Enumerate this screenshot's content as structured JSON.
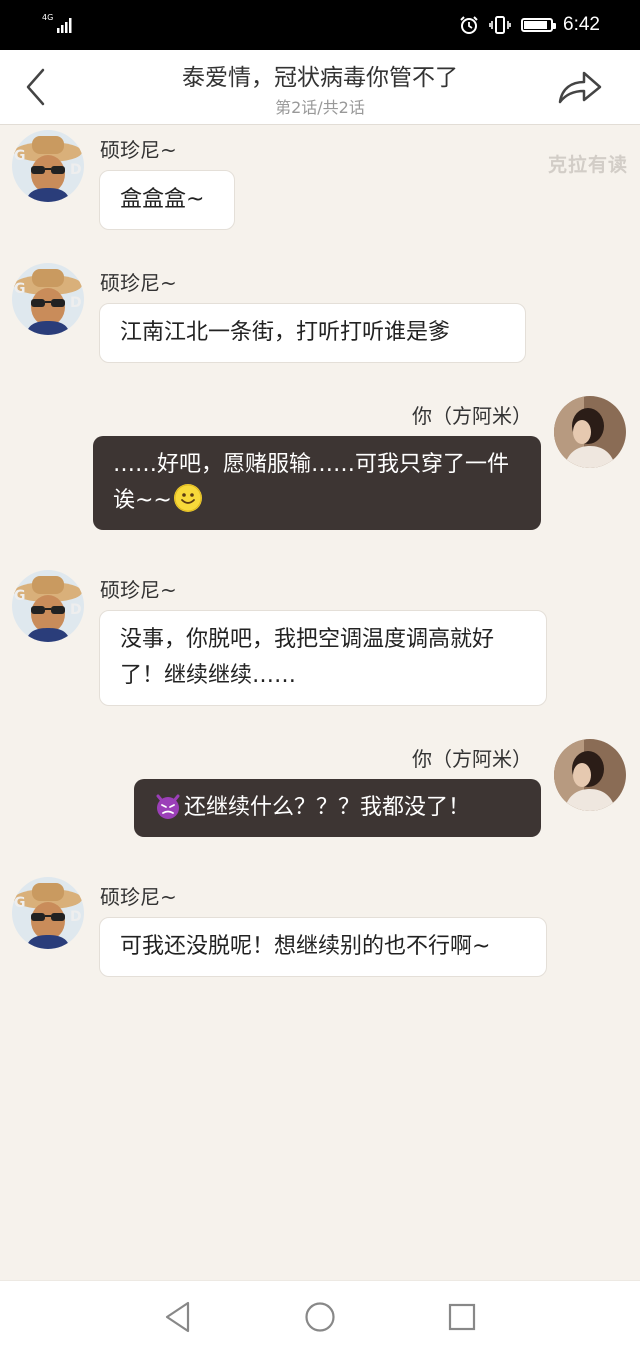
{
  "status_bar": {
    "network": "4G",
    "time": "6:42",
    "battery_level": 0.9
  },
  "header": {
    "title": "泰爱情，冠状病毒你管不了",
    "subtitle": "第2话/共2话"
  },
  "watermark": "克拉有读",
  "messages": [
    {
      "side": "left",
      "name": "硕珍尼~",
      "text": "盒盒盒~"
    },
    {
      "side": "left",
      "name": "硕珍尼~",
      "text": "江南江北一条街，打听打听谁是爹"
    },
    {
      "side": "right",
      "name": "你（方阿米）",
      "text": "……好吧，愿赌服输……可我只穿了一件诶~~",
      "emoji": "smiling-face-emoji"
    },
    {
      "side": "left",
      "name": "硕珍尼~",
      "text": "没事，你脱吧，我把空调温度调高就好了！继续继续……"
    },
    {
      "side": "right",
      "name": "你（方阿米）",
      "text": "还继续什么？？？我都没了！",
      "emoji": "angry-devil-emoji"
    },
    {
      "side": "left",
      "name": "硕珍尼~",
      "text": "可我还没脱呢！想继续别的也不行啊~"
    }
  ],
  "nav": {
    "back": "back-triangle-icon",
    "home": "home-circle-icon",
    "recents": "recents-square-icon"
  },
  "colors": {
    "background": "#f6f2ec",
    "self_bubble": "#3d3533",
    "other_bubble": "#ffffff"
  }
}
